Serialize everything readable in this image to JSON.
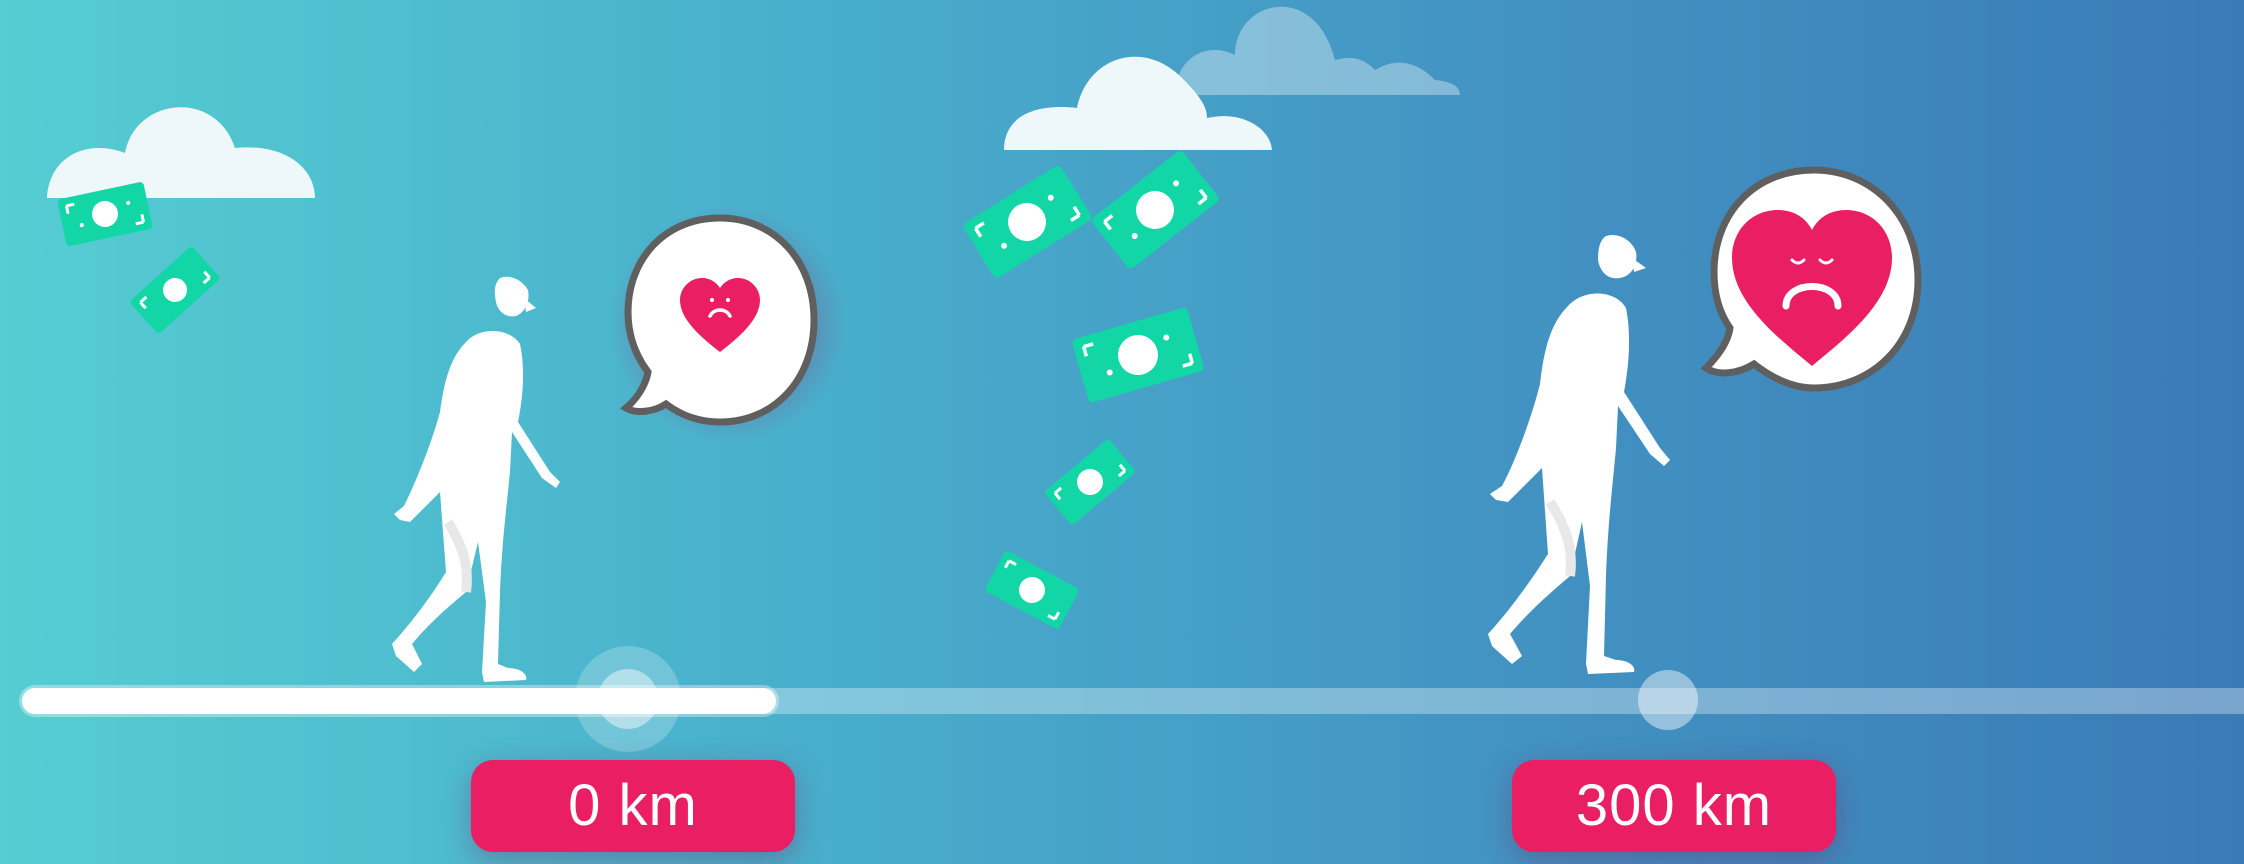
{
  "scene": {
    "colors": {
      "accent": "#e91e63",
      "money": "#13d6a6",
      "figure": "#ffffff",
      "bubble_outline": "#5f5f5f"
    },
    "icons": [
      "cloud-icon",
      "money-bill-icon",
      "walking-person-icon",
      "speech-bubble-icon",
      "sad-heart-icon"
    ]
  },
  "progress": {
    "filled_fraction": 0.34
  },
  "labels": {
    "start": "0 km",
    "end": "300 km"
  }
}
